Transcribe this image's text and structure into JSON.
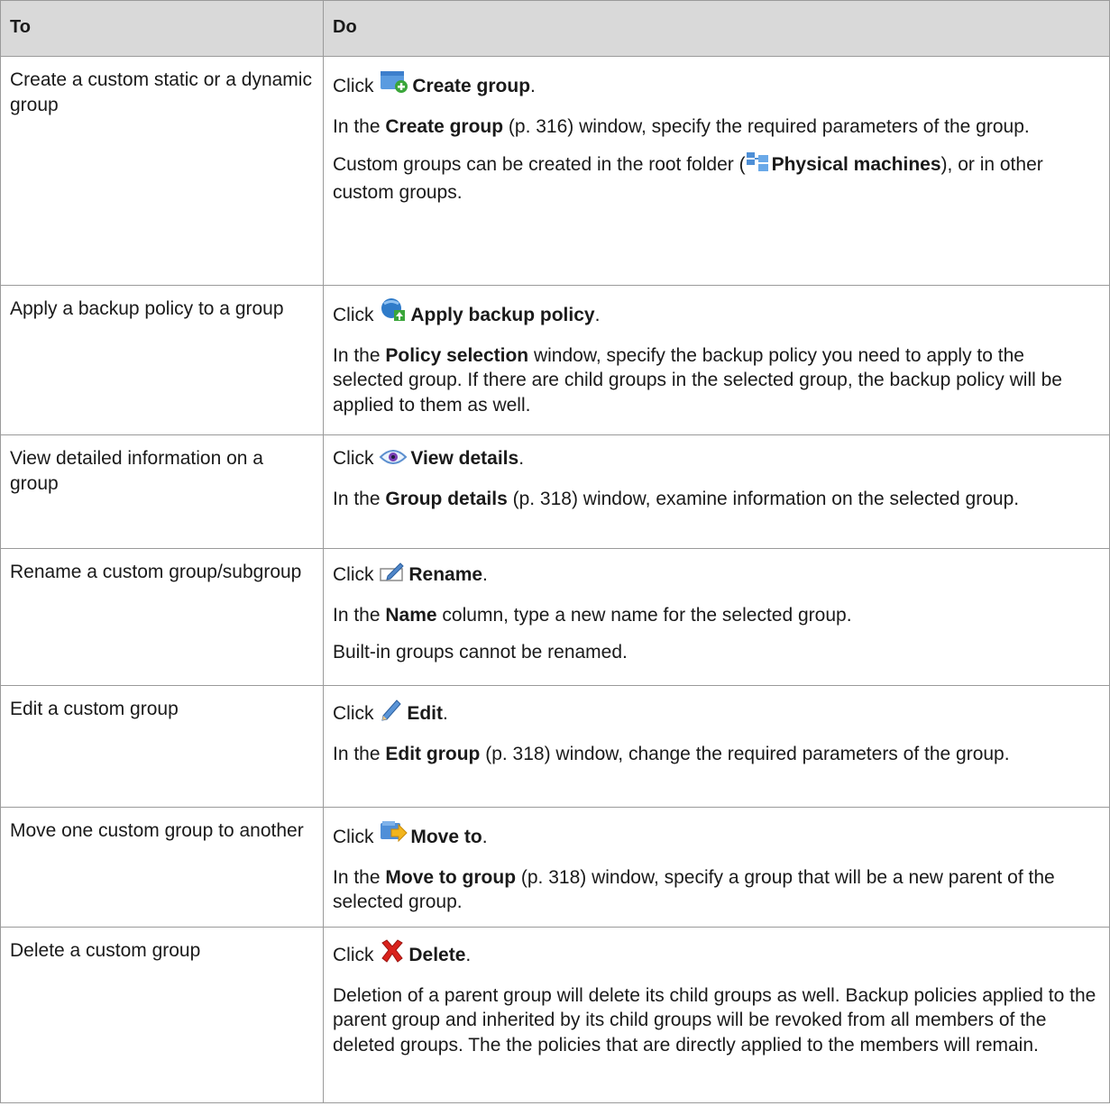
{
  "header": {
    "col_to": "To",
    "col_do": "Do"
  },
  "rows": [
    {
      "to": "Create a custom static or a dynamic group",
      "click_prefix": "Click",
      "icon": "create-group-icon",
      "action": "Create group",
      "period": ".",
      "p1": {
        "bold": "Create group",
        "ref": " (p. 316) window, specify the required parameters of the group.",
        "pre": "In the "
      },
      "p2": {
        "pre": "Custom groups can be created in the root folder (",
        "icon": "physical-machines-icon",
        "bold": "Physical machines",
        "post": "), or in other custom groups."
      }
    },
    {
      "to": "Apply a backup policy to a group",
      "click_prefix": "Click",
      "icon": "apply-backup-policy-icon",
      "action": "Apply backup policy",
      "period": ".",
      "p1": {
        "pre": "In the ",
        "bold": "Policy selection",
        "ref": " window, specify the backup policy you need to apply to the selected group. If there are child groups in the selected group, the backup policy will be applied to them as well."
      }
    },
    {
      "to": "View detailed information on a group",
      "click_prefix": "Click",
      "icon": "view-details-icon",
      "action": "View details",
      "period": ".",
      "p1": {
        "pre": "In the ",
        "bold": "Group details",
        "ref": " (p. 318) window, examine information on the selected group."
      }
    },
    {
      "to": "Rename a custom group/subgroup",
      "click_prefix": "Click",
      "icon": "rename-icon",
      "action": "Rename",
      "period": ".",
      "p1": {
        "pre": "In the ",
        "bold": "Name",
        "ref": " column, type a new name for the selected group."
      },
      "p2_text": "Built-in groups cannot be renamed."
    },
    {
      "to": "Edit a custom group",
      "click_prefix": "Click",
      "icon": "edit-icon",
      "action": "Edit",
      "period": ".",
      "p1": {
        "pre": "In the ",
        "bold": "Edit group",
        "ref": " (p. 318) window, change the required parameters of the group."
      }
    },
    {
      "to": "Move one custom group to another",
      "click_prefix": "Click",
      "icon": "move-to-icon",
      "action": "Move to",
      "period": ".",
      "p1": {
        "pre": "In the ",
        "bold": "Move to group",
        "ref": " (p. 318) window, specify a group that will be a new parent of the selected group."
      }
    },
    {
      "to": "Delete a custom group",
      "click_prefix": "Click",
      "icon": "delete-icon",
      "action": "Delete",
      "period": ".",
      "p1_text": "Deletion of a parent group will delete its child groups as well. Backup policies applied to the parent group and inherited by its child groups will be revoked from all members of the deleted groups. The the policies that are directly applied to the members will remain."
    }
  ]
}
